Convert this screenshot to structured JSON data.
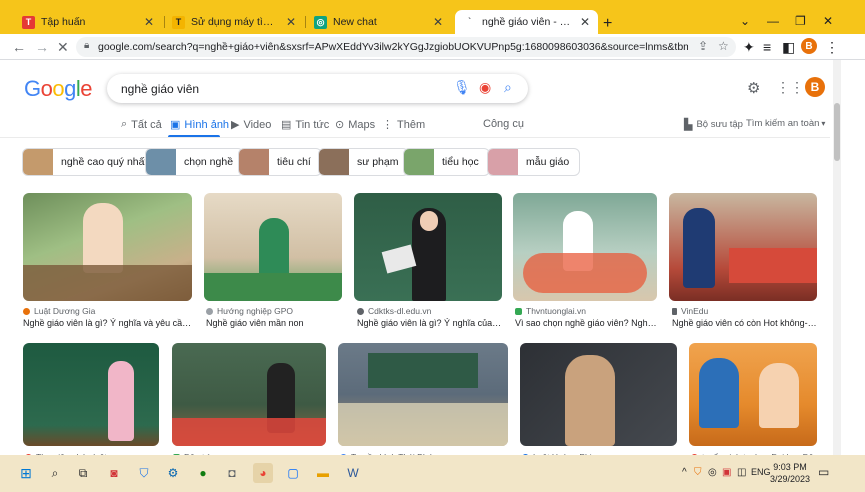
{
  "tabs": [
    {
      "label": "Tập huấn",
      "color": "#e53935",
      "glyph": "T"
    },
    {
      "label": "Sử dụng máy tìm kiếm để tìm hiể",
      "color": "#f4b400",
      "glyph": "T"
    },
    {
      "label": "New chat",
      "color": "#10a37f",
      "glyph": "◎"
    },
    {
      "label": "nghề giáo viên - Google Tìm kiế",
      "color": "#ffffff",
      "glyph": "G"
    }
  ],
  "toolbar": {
    "url": "google.com/search?q=nghề+giáo+viên&sxsrf=APwXEddYv3ilw2kYGgJzgiobUOKVUPnp5g:1680098603036&source=lnms&tbm=isch&sa=X&ved=2ahUKEwi...",
    "profile_initial": "B"
  },
  "search": {
    "query": "nghề giáo viên",
    "avatar_initial": "B"
  },
  "search_tabs": [
    {
      "label": "Tất cả",
      "icon": "search-icon",
      "active": false
    },
    {
      "label": "Hình ảnh",
      "icon": "image-icon",
      "active": true
    },
    {
      "label": "Video",
      "icon": "video-icon",
      "active": false
    },
    {
      "label": "Tin tức",
      "icon": "news-icon",
      "active": false
    },
    {
      "label": "Maps",
      "icon": "pin-icon",
      "active": false
    },
    {
      "label": "Thêm",
      "icon": "more-icon",
      "active": false
    }
  ],
  "tools_label": "Công cụ",
  "collection_label": "Bộ sưu tập",
  "safesearch_label": "Tìm kiếm an toàn",
  "chips": [
    {
      "label": "nghề cao quý nhất",
      "color": "#c49a6c"
    },
    {
      "label": "chọn nghề",
      "color": "#6d8fa8"
    },
    {
      "label": "tiêu chí",
      "color": "#b5826a"
    },
    {
      "label": "sư phạm",
      "color": "#8b6f5a"
    },
    {
      "label": "tiểu học",
      "color": "#7aa56b"
    },
    {
      "label": "mẫu giáo",
      "color": "#d8a0a8"
    }
  ],
  "results_row1": [
    {
      "source": "Luật Dương Gia",
      "caption": "Nghề giáo viên là gì? Ý nghĩa và yêu cầu của ng...",
      "bg": "#8fae7a",
      "fg": "#f3d9c0",
      "fav": "#e8710a"
    },
    {
      "source": "Hướng nghiệp GPO",
      "caption": "Nghề giáo viên mần non",
      "bg": "#d7c7b0",
      "fg": "#3d8a4a",
      "fav": "#9aa0a6"
    },
    {
      "source": "Cdktks-dl.edu.vn",
      "caption": "Nghề giáo viên là gì? Ý nghĩa của nghề g...",
      "bg": "#2f5e46",
      "fg": "#e9e9e9",
      "fav": "#5f6368"
    },
    {
      "source": "Thvntuonglai.vn",
      "caption": "Vì sao chọn nghề giáo viên? Nghề giáo ...",
      "bg": "#9ab7a6",
      "fg": "#e85b3b",
      "fav": "#34a853"
    },
    {
      "source": "VinEdu",
      "caption": "Nghề giáo viên có còn Hot không- Tố chấ...",
      "bg": "#b64a3a",
      "fg": "#1f3b73",
      "fav": "#5f6368"
    }
  ],
  "results_row2": [
    {
      "source": "Thư viện pháp luật",
      "bg": "#2d6a4e",
      "fg": "#f1b6c8",
      "fav": "#ea4335"
    },
    {
      "source": "Dân trí",
      "bg": "#3e5a44",
      "fg": "#e2463c",
      "fav": "#34a853"
    },
    {
      "source": "Truyền hình Thái Bình",
      "bg": "#5c6b7a",
      "fg": "#d9d2b6",
      "fav": "#4285f4"
    },
    {
      "source": "Luật Hoàng Phi",
      "bg": "#3a3d42",
      "fg": "#c9a27d",
      "fav": "#1a73e8"
    },
    {
      "source": "tuyển sinh trường Đại học Đông",
      "bg": "#e58a2c",
      "fg": "#2c6fb8",
      "fav": "#ea4335"
    }
  ],
  "taskbar": {
    "time": "9:03 PM",
    "date": "3/29/2023",
    "lang": "ENG"
  }
}
